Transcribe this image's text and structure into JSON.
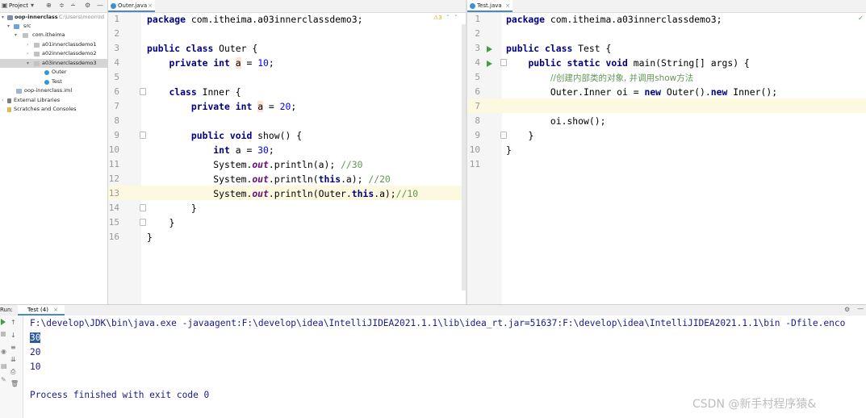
{
  "project": {
    "toolbar_label": "Project",
    "tree": [
      {
        "label": "oop-innerclass",
        "sub": "C:\\Users\\moon\\Id"
      },
      {
        "label": "src",
        "sub": ""
      },
      {
        "label": "com.itheima",
        "sub": ""
      },
      {
        "label": "a01innerclassdemo1",
        "sub": ""
      },
      {
        "label": "a02innerclassdemo2",
        "sub": ""
      },
      {
        "label": "a03innerclassdemo3",
        "sub": ""
      },
      {
        "label": "Outer",
        "sub": ""
      },
      {
        "label": "Test",
        "sub": ""
      },
      {
        "label": "oop-innerclass.iml",
        "sub": ""
      },
      {
        "label": "External Libraries",
        "sub": ""
      },
      {
        "label": "Scratches and Consoles",
        "sub": ""
      }
    ]
  },
  "left_editor": {
    "tab": "Outer.java",
    "warning_count": "3",
    "line_numbers": [
      "1",
      "2",
      "3",
      "4",
      "5",
      "6",
      "7",
      "8",
      "9",
      "10",
      "11",
      "12",
      "13",
      "14",
      "15",
      "16"
    ],
    "t": {
      "l1a": "package ",
      "l1b": "com.itheima.a03innerclassdemo3;",
      "public": "public",
      "class": "class",
      "outer_name": " Outer {",
      "private": "private",
      "int": "int",
      "a": "a",
      "eq": " = ",
      "ten": "10",
      "semi": ";",
      "inner_name": " Inner {",
      "twenty": "20",
      "void": "void",
      "show": " show() {",
      "thirty": "30",
      "sys": "System.",
      "out": "out",
      "println": ".println(",
      "l11_arg": "a); ",
      "c30": "//30",
      "this": "this",
      "l12_mid": ".a); ",
      "c20": "//20",
      "l13_open": "Outer.",
      "l13_mid": ".a);",
      "c10": "//10",
      "close": "}"
    }
  },
  "right_editor": {
    "tab": "Test.java",
    "line_numbers": [
      "1",
      "2",
      "3",
      "4",
      "5",
      "6",
      "7",
      "8",
      "9",
      "10",
      "11"
    ],
    "t": {
      "l1a": "package ",
      "l1b": "com.itheima.a03innerclassdemo3;",
      "public": "public",
      "class": "class",
      "test_name": " Test {",
      "static": "static",
      "void": "void",
      "main": " main(String[] args) {",
      "comment": "//创建内部类的对象, 并调用show方法",
      "l6a": "Outer.Inner oi = ",
      "new": "new",
      "l6b": " Outer().",
      "l6c": " Inner();",
      "l8": "oi.show();",
      "close": "}"
    }
  },
  "run": {
    "label": "Run:",
    "tab": "Test (4)",
    "command": "F:\\develop\\JDK\\bin\\java.exe -javaagent:F:\\develop\\idea\\IntelliJIDEA2021.1.1\\lib\\idea_rt.jar=51637:F:\\develop\\idea\\IntelliJIDEA2021.1.1\\bin -Dfile.enco",
    "output": [
      "30",
      "20",
      "10"
    ],
    "finished": "Process finished with exit code 0"
  },
  "watermark": "CSDN @新手村程序猿&"
}
